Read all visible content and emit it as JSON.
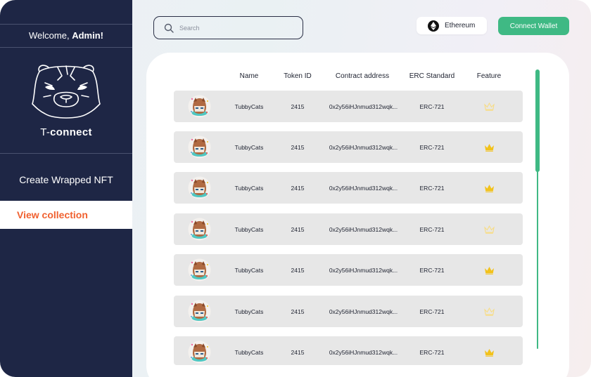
{
  "sidebar": {
    "welcome_prefix": "Welcome, ",
    "welcome_user": "Admin!",
    "brand_prefix": "T-",
    "brand_name": "connect",
    "nav": [
      {
        "label": "Create Wrapped NFT",
        "active": false
      },
      {
        "label": "View collection",
        "active": true
      }
    ]
  },
  "header": {
    "search_placeholder": "Search",
    "chain_label": "Ethereum",
    "connect_label": "Connect Wallet"
  },
  "table": {
    "columns": [
      "Name",
      "Token ID",
      "Contract address",
      "ERC Standard",
      "Feature"
    ],
    "rows": [
      {
        "name": "TubbyCats",
        "token_id": "2415",
        "contract": "0x2y56iHJnmud312wqk...",
        "standard": "ERC-721",
        "feature_active": false
      },
      {
        "name": "TubbyCats",
        "token_id": "2415",
        "contract": "0x2y56iHJnmud312wqk...",
        "standard": "ERC-721",
        "feature_active": true
      },
      {
        "name": "TubbyCats",
        "token_id": "2415",
        "contract": "0x2y56iHJnmud312wqk...",
        "standard": "ERC-721",
        "feature_active": true
      },
      {
        "name": "TubbyCats",
        "token_id": "2415",
        "contract": "0x2y56iHJnmud312wqk...",
        "standard": "ERC-721",
        "feature_active": false
      },
      {
        "name": "TubbyCats",
        "token_id": "2415",
        "contract": "0x2y56iHJnmud312wqk...",
        "standard": "ERC-721",
        "feature_active": true
      },
      {
        "name": "TubbyCats",
        "token_id": "2415",
        "contract": "0x2y56iHJnmud312wqk...",
        "standard": "ERC-721",
        "feature_active": false
      },
      {
        "name": "TubbyCats",
        "token_id": "2415",
        "contract": "0x2y56iHJnmud312wqk...",
        "standard": "ERC-721",
        "feature_active": true
      }
    ]
  },
  "colors": {
    "sidebar_bg": "#1e2645",
    "accent_orange": "#f0602f",
    "accent_green": "#3fb984",
    "crown_active": "#f2c21b",
    "crown_inactive": "#f7dc86"
  }
}
